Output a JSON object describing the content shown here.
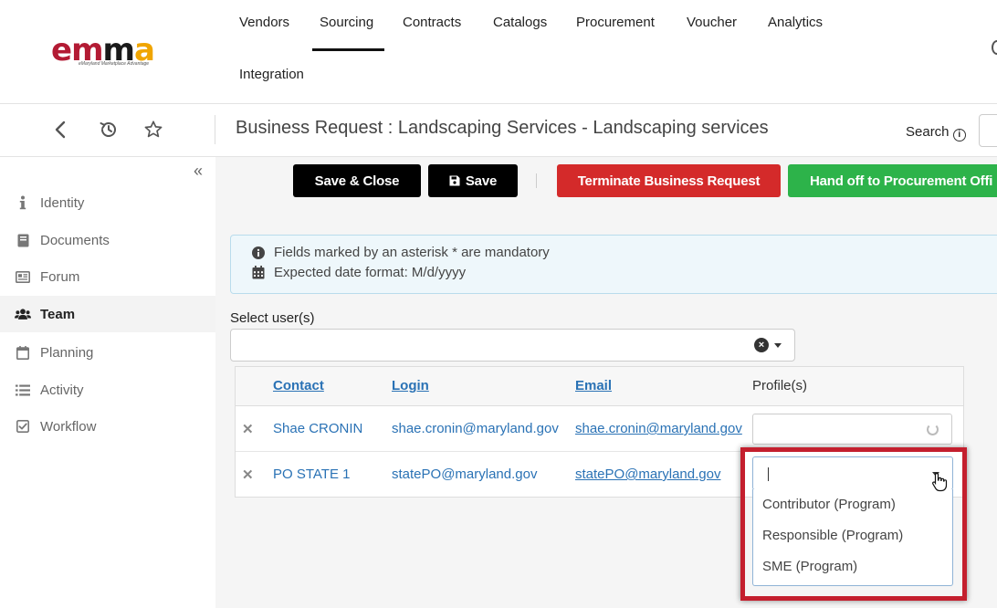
{
  "app": {
    "logo_text": "emma",
    "logo_tagline": "eMaryland Marketplace Advantage"
  },
  "nav": {
    "items": [
      {
        "label": "Vendors"
      },
      {
        "label": "Sourcing",
        "active": true
      },
      {
        "label": "Contracts"
      },
      {
        "label": "Catalogs"
      },
      {
        "label": "Procurement"
      },
      {
        "label": "Voucher"
      },
      {
        "label": "Analytics"
      },
      {
        "label": "Integration"
      }
    ]
  },
  "header": {
    "title": "Business Request : Landscaping Services - Landscaping services",
    "search_label": "Search"
  },
  "sidebar": {
    "items": [
      {
        "label": "Identity",
        "icon": "info-icon"
      },
      {
        "label": "Documents",
        "icon": "book-icon"
      },
      {
        "label": "Forum",
        "icon": "newspaper-icon"
      },
      {
        "label": "Team",
        "icon": "users-icon",
        "active": true
      },
      {
        "label": "Planning",
        "icon": "calendar-icon"
      },
      {
        "label": "Activity",
        "icon": "list-icon"
      },
      {
        "label": "Workflow",
        "icon": "checkbox-icon"
      }
    ]
  },
  "toolbar": {
    "save_close_label": "Save & Close",
    "save_label": "Save",
    "terminate_label": "Terminate Business Request",
    "handoff_label": "Hand off to Procurement Offi"
  },
  "info": {
    "mandatory_text": "Fields marked by an asterisk * are mandatory",
    "date_format_text": "Expected date format: M/d/yyyy"
  },
  "user_select": {
    "label": "Select user(s)",
    "value": ""
  },
  "team_table": {
    "headers": {
      "contact": "Contact",
      "login": "Login",
      "email": "Email",
      "profiles": "Profile(s)"
    },
    "rows": [
      {
        "contact": "Shae CRONIN",
        "login": "shae.cronin@maryland.gov",
        "email": "shae.cronin@maryland.gov"
      },
      {
        "contact": "PO STATE 1",
        "login": "statePO@maryland.gov",
        "email": "statePO@maryland.gov"
      }
    ]
  },
  "profile_dropdown": {
    "value": "",
    "options": [
      "Contributor (Program)",
      "Responsible (Program)",
      "SME (Program)"
    ]
  },
  "colors": {
    "accent_blue": "#2a72b5",
    "terminate_red": "#d42a2a",
    "handoff_green": "#2db34a",
    "highlight_frame": "#c41f2e"
  }
}
